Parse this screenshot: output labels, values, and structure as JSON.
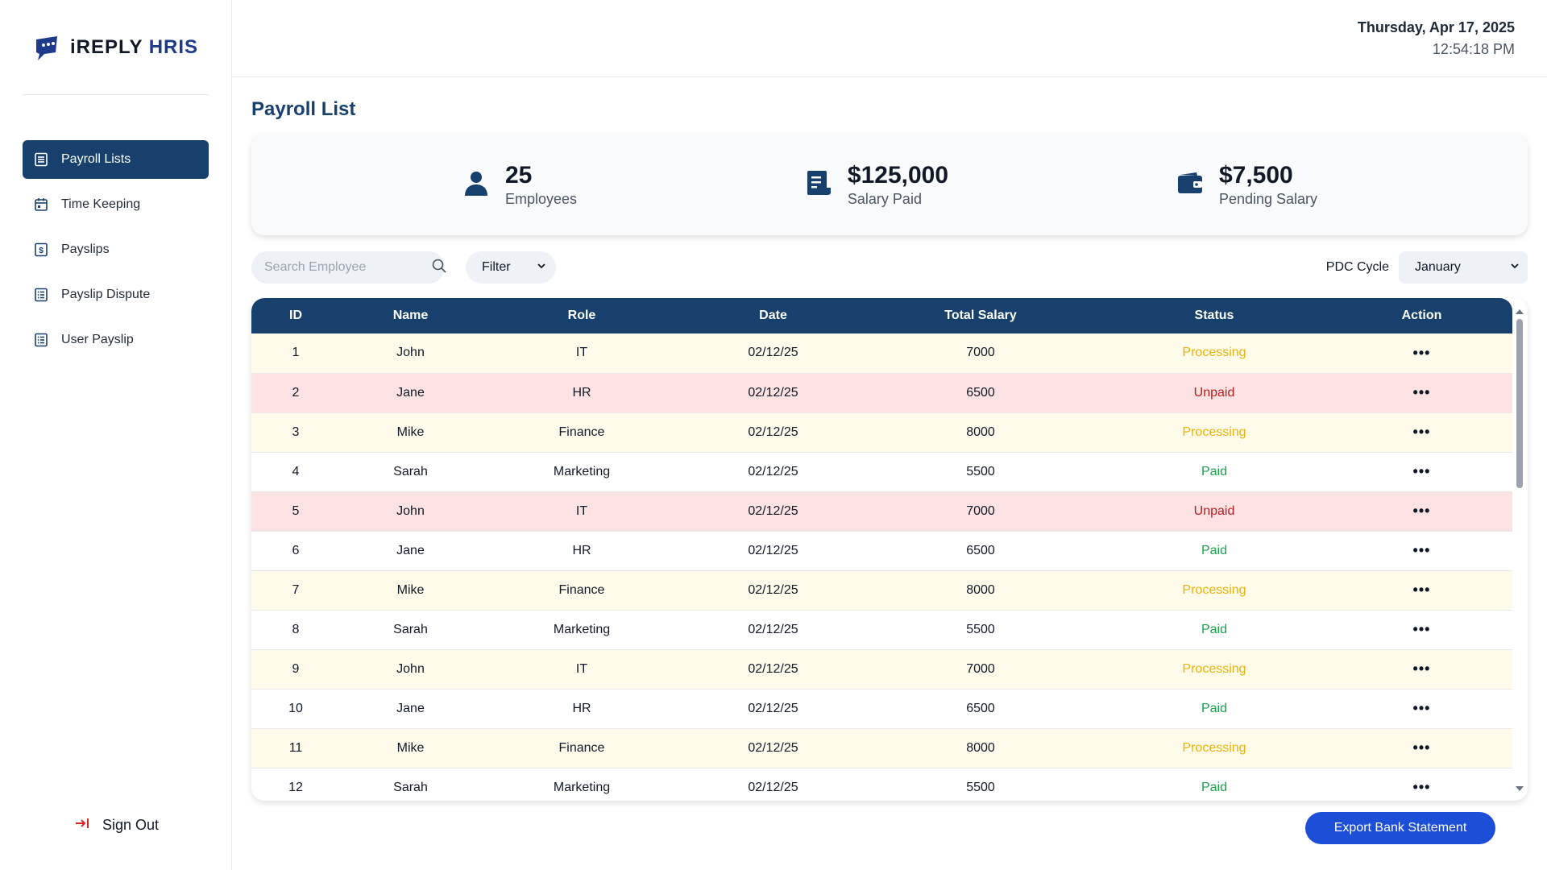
{
  "brand": {
    "name_part1": "iREPLY",
    "name_part2": "HRIS",
    "accent_color": "#1e3a8a"
  },
  "sidebar": {
    "items": [
      {
        "label": "Payroll Lists",
        "icon": "list-icon",
        "active": true
      },
      {
        "label": "Time Keeping",
        "icon": "calendar-icon",
        "active": false
      },
      {
        "label": "Payslips",
        "icon": "dollar-doc-icon",
        "active": false
      },
      {
        "label": "Payslip Dispute",
        "icon": "doc-list-icon",
        "active": false
      },
      {
        "label": "User Payslip",
        "icon": "doc-list-icon",
        "active": false
      }
    ],
    "signout_label": "Sign Out"
  },
  "header": {
    "date": "Thursday, Apr 17, 2025",
    "time": "12:54:18 PM"
  },
  "page": {
    "title": "Payroll List"
  },
  "stats": [
    {
      "value": "25",
      "label": "Employees",
      "icon": "user-icon"
    },
    {
      "value": "$125,000",
      "label": "Salary Paid",
      "icon": "receipt-icon"
    },
    {
      "value": "$7,500",
      "label": "Pending Salary",
      "icon": "wallet-icon"
    }
  ],
  "toolbar": {
    "search_placeholder": "Search Employee",
    "filter_label": "Filter",
    "pdc_label": "PDC Cycle",
    "pdc_value": "January"
  },
  "table": {
    "columns": [
      "ID",
      "Name",
      "Role",
      "Date",
      "Total Salary",
      "Status",
      "Action"
    ],
    "rows": [
      {
        "id": "1",
        "name": "John",
        "role": "IT",
        "date": "02/12/25",
        "salary": "7000",
        "status": "Processing",
        "action": "•••"
      },
      {
        "id": "2",
        "name": "Jane",
        "role": "HR",
        "date": "02/12/25",
        "salary": "6500",
        "status": "Unpaid",
        "action": "•••"
      },
      {
        "id": "3",
        "name": "Mike",
        "role": "Finance",
        "date": "02/12/25",
        "salary": "8000",
        "status": "Processing",
        "action": "•••"
      },
      {
        "id": "4",
        "name": "Sarah",
        "role": "Marketing",
        "date": "02/12/25",
        "salary": "5500",
        "status": "Paid",
        "action": "•••"
      },
      {
        "id": "5",
        "name": "John",
        "role": "IT",
        "date": "02/12/25",
        "salary": "7000",
        "status": "Unpaid",
        "action": "•••"
      },
      {
        "id": "6",
        "name": "Jane",
        "role": "HR",
        "date": "02/12/25",
        "salary": "6500",
        "status": "Paid",
        "action": "•••"
      },
      {
        "id": "7",
        "name": "Mike",
        "role": "Finance",
        "date": "02/12/25",
        "salary": "8000",
        "status": "Processing",
        "action": "•••"
      },
      {
        "id": "8",
        "name": "Sarah",
        "role": "Marketing",
        "date": "02/12/25",
        "salary": "5500",
        "status": "Paid",
        "action": "•••"
      },
      {
        "id": "9",
        "name": "John",
        "role": "IT",
        "date": "02/12/25",
        "salary": "7000",
        "status": "Processing",
        "action": "•••"
      },
      {
        "id": "10",
        "name": "Jane",
        "role": "HR",
        "date": "02/12/25",
        "salary": "6500",
        "status": "Paid",
        "action": "•••"
      },
      {
        "id": "11",
        "name": "Mike",
        "role": "Finance",
        "date": "02/12/25",
        "salary": "8000",
        "status": "Processing",
        "action": "•••"
      },
      {
        "id": "12",
        "name": "Sarah",
        "role": "Marketing",
        "date": "02/12/25",
        "salary": "5500",
        "status": "Paid",
        "action": "•••"
      }
    ]
  },
  "footer": {
    "export_label": "Export Bank Statement"
  },
  "colors": {
    "primary": "#17406d",
    "button": "#1d4ed8",
    "processing": "#eab308",
    "unpaid": "#b91c1c",
    "paid": "#16a34a"
  }
}
